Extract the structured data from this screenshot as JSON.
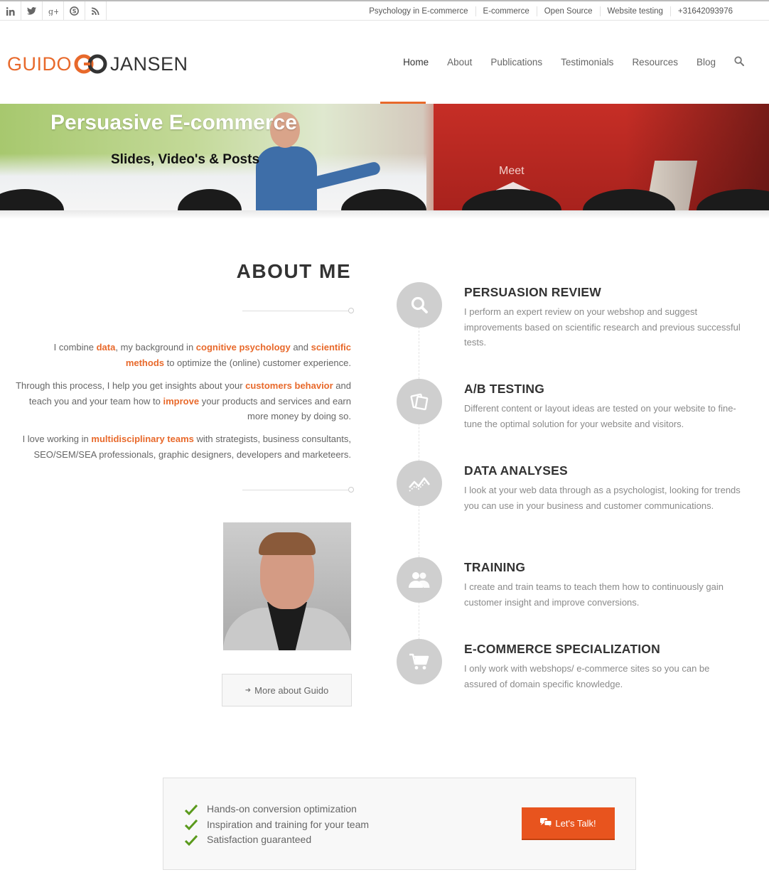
{
  "topbar": {
    "social": [
      {
        "name": "linkedin-icon",
        "glyph": "in"
      },
      {
        "name": "twitter-icon",
        "glyph": "twitter"
      },
      {
        "name": "googleplus-icon",
        "glyph": "g+"
      },
      {
        "name": "skype-icon",
        "glyph": "skype"
      },
      {
        "name": "rss-icon",
        "glyph": "rss"
      }
    ],
    "links": [
      "Psychology in E-commerce",
      "E-commerce",
      "Open Source",
      "Website testing",
      "+31642093976"
    ]
  },
  "header": {
    "logo_first": "GUIDO",
    "logo_last": "JANSEN",
    "nav": [
      "Home",
      "About",
      "Publications",
      "Testimonials",
      "Resources",
      "Blog"
    ],
    "active_nav": "Home"
  },
  "banner": {
    "title": "Persuasive E-commerce",
    "subtitle": "Slides, Video's & Posts",
    "sign_text": "Meet"
  },
  "about": {
    "title": "ABOUT ME",
    "p1": [
      "I combine ",
      "data",
      ", my background in ",
      "cognitive psychology",
      " and ",
      "scientific methods",
      " to optimize the (online) customer experience."
    ],
    "p2": [
      "Through this process, I help you get insights about your ",
      "customers behavior",
      " and teach you and your team how to ",
      "improve",
      " your products and services and earn more money by doing so."
    ],
    "p3": [
      "I love working in ",
      "multidisciplinary teams",
      " with strategists, business consultants, SEO/SEM/SEA professionals, graphic designers, developers and marketeers."
    ],
    "more_button": "More about Guido"
  },
  "services": [
    {
      "icon": "search-icon",
      "title": "PERSUASION REVIEW",
      "text": "I perform an expert review on your webshop and suggest improvements based on scientific research and previous successful tests."
    },
    {
      "icon": "ab-testing-icon",
      "title": "A/B TESTING",
      "text": "Different content or layout ideas are tested on your website to fine-tune the optimal solution for your website and visitors."
    },
    {
      "icon": "chart-line-icon",
      "title": "DATA ANALYSES",
      "text": "I look at your web data through as a psychologist, looking for trends you can use in your business and customer communications."
    },
    {
      "icon": "users-icon",
      "title": "TRAINING",
      "text": "I create and train teams to teach them how to continuously gain customer insight and improve conversions."
    },
    {
      "icon": "cart-icon",
      "title": "E-COMMERCE SPECIALIZATION",
      "text": "I only work with webshops/ e-commerce sites so you can be assured of domain specific knowledge."
    }
  ],
  "cta": {
    "items": [
      "Hands-on conversion optimization",
      "Inspiration and training for your team",
      "Satisfaction guaranteed"
    ],
    "button": "Let's Talk!"
  },
  "colors": {
    "accent": "#e8692b",
    "button": "#e8541e",
    "check": "#5a9a1c",
    "icon_circle": "#cfcfcf"
  }
}
